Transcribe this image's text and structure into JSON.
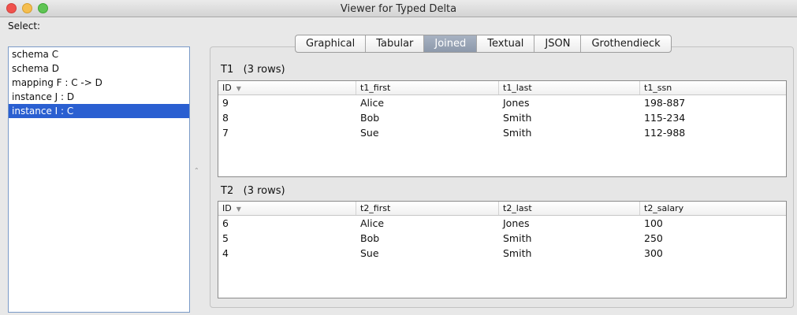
{
  "window": {
    "title": "Viewer for Typed Delta"
  },
  "sidebar": {
    "label": "Select:",
    "items": [
      {
        "label": "schema C",
        "selected": false
      },
      {
        "label": "schema D",
        "selected": false
      },
      {
        "label": "mapping F : C -> D",
        "selected": false
      },
      {
        "label": "instance J : D",
        "selected": false
      },
      {
        "label": "instance I : C",
        "selected": true
      }
    ]
  },
  "tabs": [
    {
      "label": "Graphical",
      "active": false
    },
    {
      "label": "Tabular",
      "active": false
    },
    {
      "label": "Joined",
      "active": true
    },
    {
      "label": "Textual",
      "active": false
    },
    {
      "label": "JSON",
      "active": false
    },
    {
      "label": "Grothendieck",
      "active": false
    }
  ],
  "tables": [
    {
      "name": "T1",
      "row_count": "(3 rows)",
      "columns": [
        "ID",
        "t1_first",
        "t1_last",
        "t1_ssn"
      ],
      "rows": [
        [
          "9",
          "Alice",
          "Jones",
          "198-887"
        ],
        [
          "8",
          "Bob",
          "Smith",
          "115-234"
        ],
        [
          "7",
          "Sue",
          "Smith",
          "112-988"
        ]
      ]
    },
    {
      "name": "T2",
      "row_count": "(3 rows)",
      "columns": [
        "ID",
        "t2_first",
        "t2_last",
        "t2_salary"
      ],
      "rows": [
        [
          "6",
          "Alice",
          "Jones",
          "100"
        ],
        [
          "5",
          "Bob",
          "Smith",
          "250"
        ],
        [
          "4",
          "Sue",
          "Smith",
          "300"
        ]
      ]
    }
  ],
  "colors": {
    "selection": "#2a5fd1",
    "active_tab": "#97a3b5",
    "list_border": "#7a9ac7"
  }
}
